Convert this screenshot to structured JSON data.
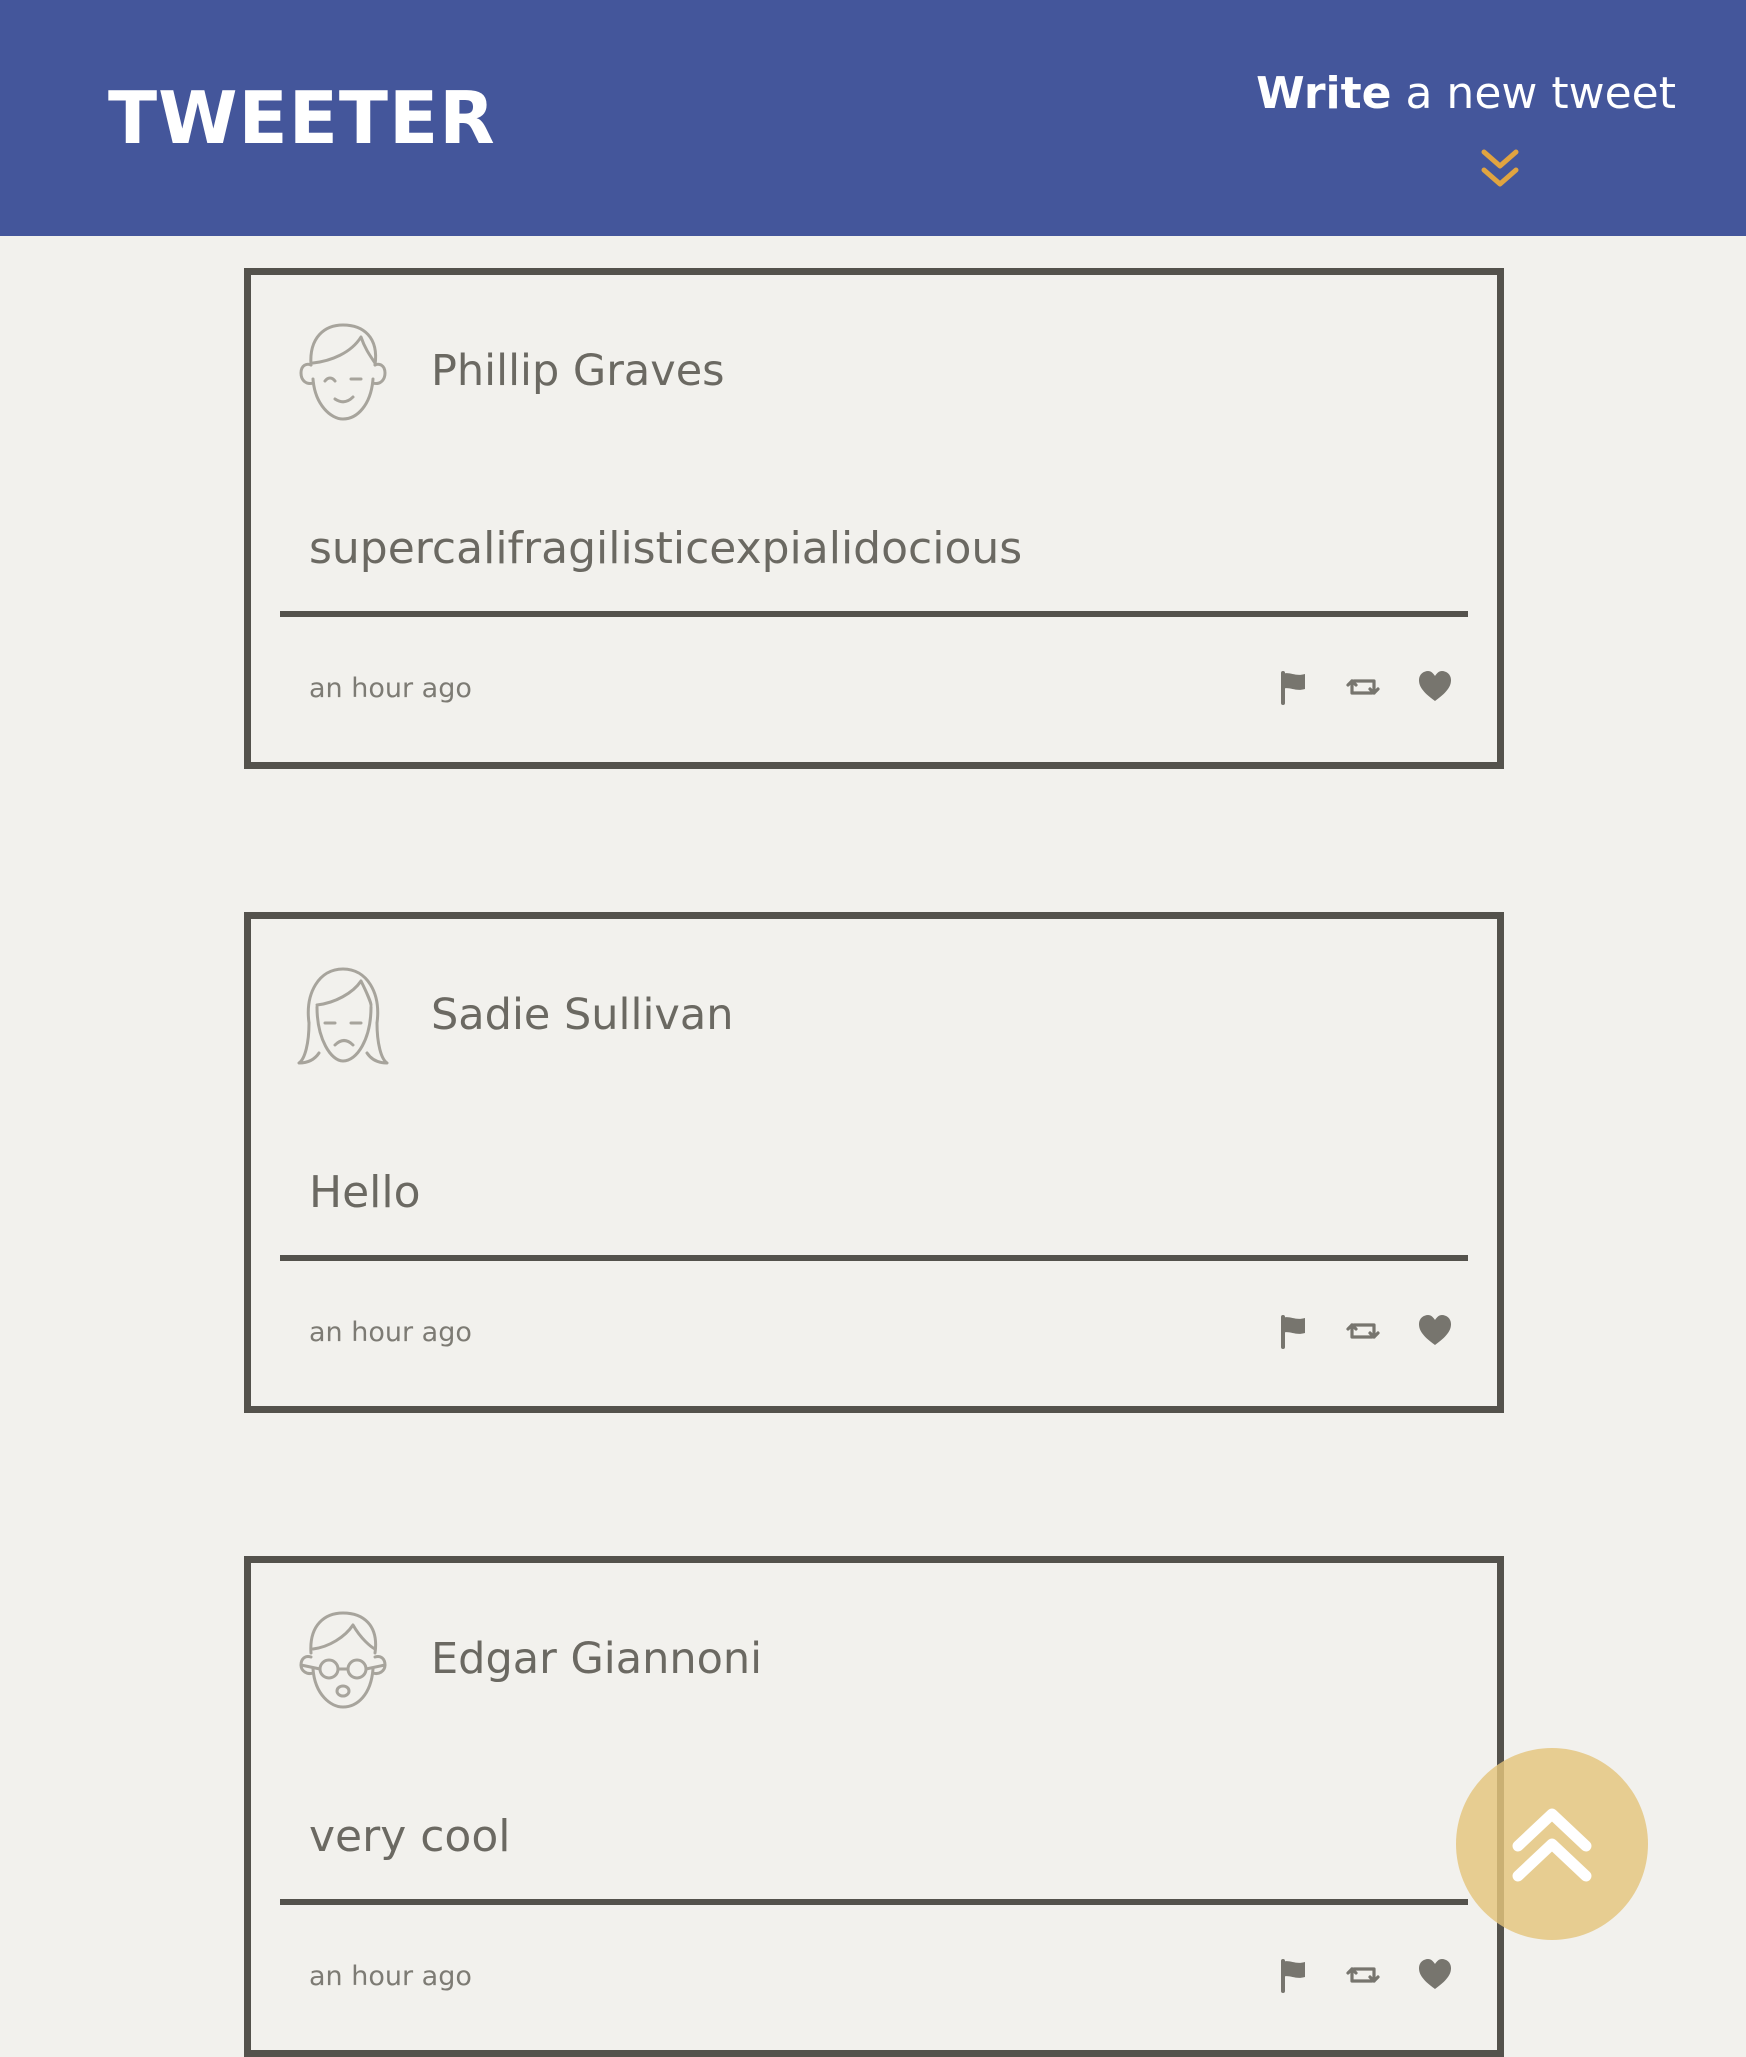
{
  "header": {
    "brand": "TWEETER",
    "compose_strong": "Write",
    "compose_light": " a new tweet",
    "compose_icon": "double-chevron-down-icon",
    "accent_color": "#e1a440",
    "nav_color": "#44569b"
  },
  "tweets": [
    {
      "author": "Phillip Graves",
      "avatar": "male-face-avatar",
      "content": "supercalifragilisticexpialidocious",
      "timestamp": "an hour ago",
      "actions": [
        "flag-icon",
        "retweet-icon",
        "heart-icon"
      ]
    },
    {
      "author": "Sadie Sullivan",
      "avatar": "female-face-avatar",
      "content": "Hello",
      "timestamp": "an hour ago",
      "actions": [
        "flag-icon",
        "retweet-icon",
        "heart-icon"
      ]
    },
    {
      "author": "Edgar Giannoni",
      "avatar": "glasses-face-avatar",
      "content": "very cool",
      "timestamp": "an hour ago",
      "actions": [
        "flag-icon",
        "retweet-icon",
        "heart-icon"
      ]
    }
  ],
  "scroll_top": {
    "icon": "double-chevron-up-icon",
    "color": "#e4c47d"
  }
}
